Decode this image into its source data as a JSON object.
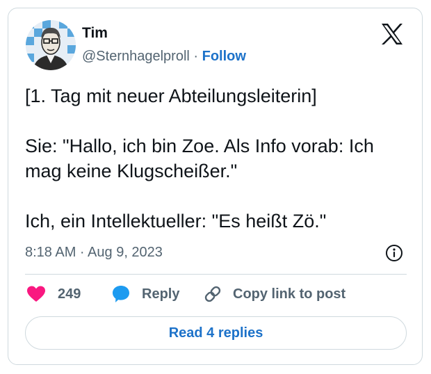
{
  "author": {
    "name": "Tim",
    "handle": "@Sternhagelproll",
    "separator": " · ",
    "follow_label": "Follow",
    "avatar_icon": "avatar-portrait-icon"
  },
  "brand": {
    "logo_icon": "x-logo-icon"
  },
  "tweet": {
    "paragraphs": [
      "[1. Tag mit neuer Abteilungsleiterin]",
      "Sie: \"Hallo, ich bin Zoe. Als Info vorab: Ich mag keine Klugscheißer.\"",
      "Ich, ein Intellektueller: \"Es heißt Zö.\""
    ],
    "timestamp": "8:18 AM · Aug 9, 2023"
  },
  "actions": {
    "like_count": "249",
    "reply_label": "Reply",
    "copy_label": "Copy link to post",
    "read_replies_label": "Read 4 replies"
  },
  "colors": {
    "accent": "#1d72c9",
    "like": "#f91880",
    "reply": "#1d9bf0",
    "muted_text": "#536471",
    "border": "#cfd9de"
  }
}
